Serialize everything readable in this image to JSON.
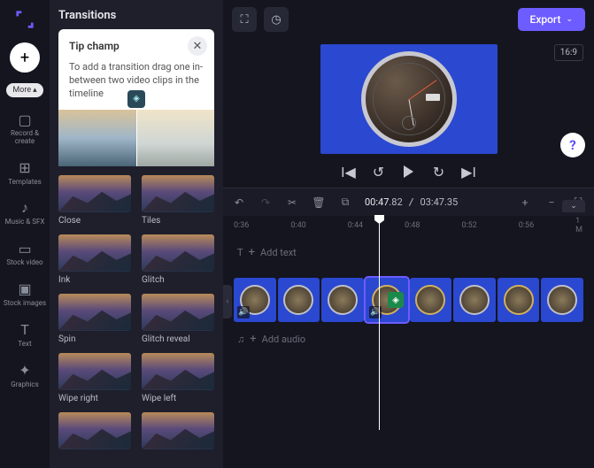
{
  "rail": {
    "more": "More",
    "items": [
      {
        "icon": "camcorder",
        "label": "Record & create"
      },
      {
        "icon": "grid",
        "label": "Templates"
      },
      {
        "icon": "music",
        "label": "Music & SFX"
      },
      {
        "icon": "film",
        "label": "Stock video"
      },
      {
        "icon": "image",
        "label": "Stock images"
      },
      {
        "icon": "text",
        "label": "Text"
      },
      {
        "icon": "sparkle",
        "label": "Graphics"
      }
    ]
  },
  "panel": {
    "title": "Transitions",
    "tip": {
      "title": "Tip champ",
      "text": "To add a transition drag one in-between two video clips in the timeline"
    },
    "items": [
      {
        "label": "Close"
      },
      {
        "label": "Tiles"
      },
      {
        "label": "Ink"
      },
      {
        "label": "Glitch"
      },
      {
        "label": "Spin"
      },
      {
        "label": "Glitch reveal"
      },
      {
        "label": "Wipe right"
      },
      {
        "label": "Wipe left"
      }
    ]
  },
  "toolbar": {
    "export": "Export"
  },
  "stage": {
    "ratio": "16:9"
  },
  "time": {
    "current": "00:47",
    "current_ms": ".82",
    "total": "03:47",
    "total_ms": ".35"
  },
  "ruler": [
    "0:36",
    "0:40",
    "0:44",
    "0:48",
    "0:52",
    "0:56",
    "1 M"
  ],
  "timeline": {
    "add_text": "Add text",
    "add_audio": "Add audio"
  }
}
